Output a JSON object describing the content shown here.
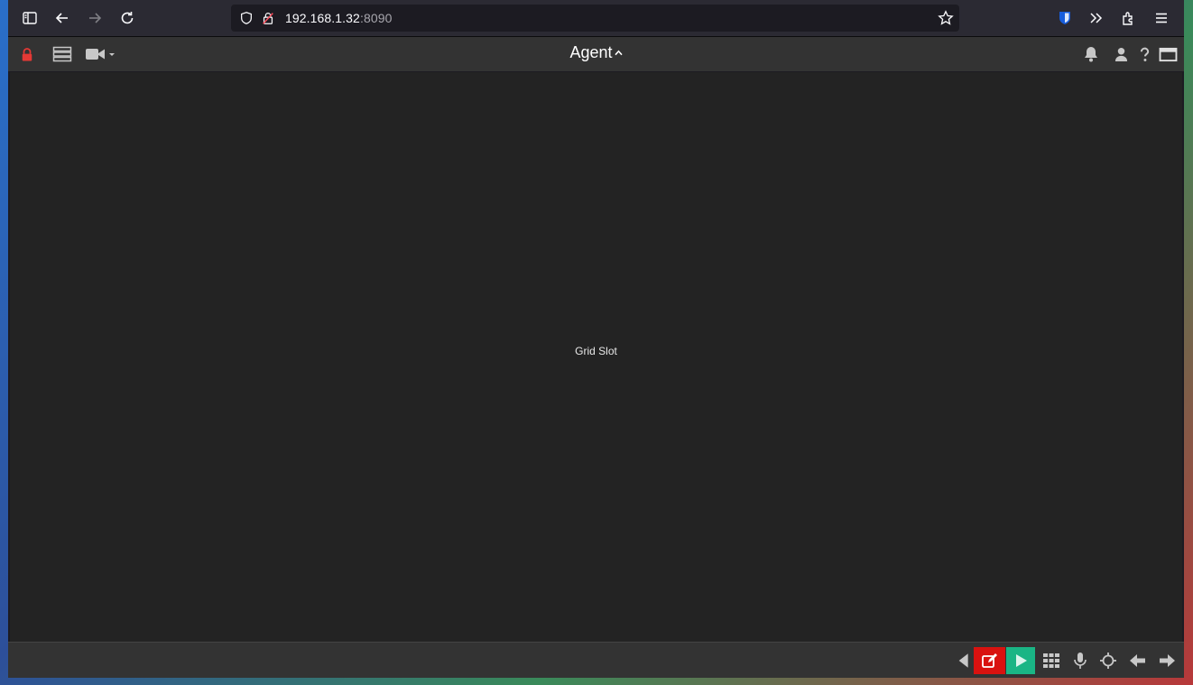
{
  "browser": {
    "url_host": "192.168.1.32",
    "url_port": ":8090",
    "icons": [
      "sidebar-icon",
      "back-icon",
      "forward-icon",
      "reload-icon",
      "shield-icon",
      "insecure-lock-icon",
      "bookmark-star-icon",
      "bitwarden-icon",
      "overflow-icon",
      "extensions-icon",
      "menu-icon"
    ]
  },
  "app": {
    "title": "Agent",
    "title_caret": "^",
    "lock_color": "#e53935",
    "left_icons": [
      "lock-icon",
      "server-icon",
      "camera-icon"
    ],
    "right_icons": [
      "bell-icon",
      "user-icon",
      "help-icon",
      "window-icon"
    ]
  },
  "grid": {
    "slot_label": "Grid Slot"
  },
  "bottom_bar": {
    "icons": [
      "volume-icon",
      "edit-icon",
      "play-icon",
      "grid-layout-icon",
      "microphone-icon",
      "ptz-icon",
      "arrow-left-icon",
      "arrow-right-icon"
    ],
    "edit_color": "#d9120f",
    "play_color": "#1ab585"
  }
}
